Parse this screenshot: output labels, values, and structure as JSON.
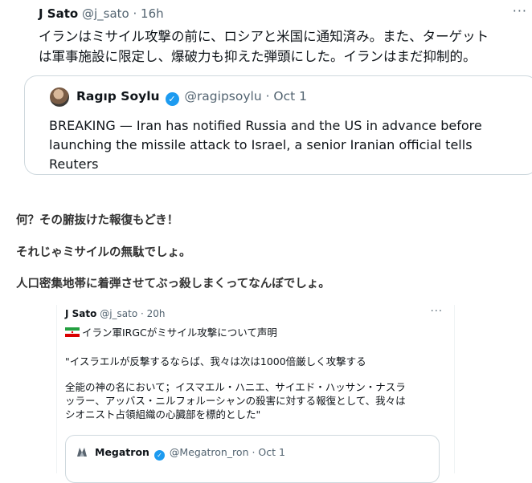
{
  "tweet1": {
    "author_name": "J Sato",
    "handle_time": "@j_sato · 16h",
    "more_label": "···",
    "lines": [
      "イランはミサイル攻撃の前に、ロシアと米国に通知済み。また、ターゲット",
      "は軍事施設に限定し、爆破力も抑えた弾頭にした。イランはまだ抑制的。"
    ],
    "quote": {
      "author_name": "Ragıp Soylu",
      "handle_time": "@ragipsoylu · Oct 1",
      "lines": [
        "BREAKING — Iran has notified Russia and the US in advance before",
        "launching the missile attack to Israel, a senior Iranian official tells",
        "Reuters"
      ]
    }
  },
  "comments": [
    "何？その腑抜けた報復もどき！",
    "それじゃミサイルの無駄でしょ。",
    "人口密集地帯に着弾させてぶっ殺しまくってなんぼでしょ。"
  ],
  "tweet2": {
    "author_name": "J Sato",
    "handle_time": "@j_sato · 20h",
    "more_label": "···",
    "line1": "イラン軍IRGCがミサイル攻撃について声明",
    "line2": "\"イスラエルが反撃するならば、我々は次は1000倍厳しく攻撃する",
    "para_lines": [
      "全能の神の名において；イスマエル・ハニエ、サイエド・ハッサン・ナスラ",
      "ッラー、アッバス・ニルフォルーシャンの殺害に対する報復として、我々は",
      "シオニスト占領組織の心臓部を標的とした\""
    ],
    "quote": {
      "author_name": "Megatron",
      "handle_time": "@Megatron_ron · Oct 1"
    }
  },
  "colors": {
    "text": "#0f1419",
    "muted": "#536471",
    "verified": "#1d9bf0",
    "border": "#cfd9de"
  },
  "icons": [
    "verified-badge-icon",
    "more-icon",
    "iran-flag-icon",
    "avatar"
  ]
}
